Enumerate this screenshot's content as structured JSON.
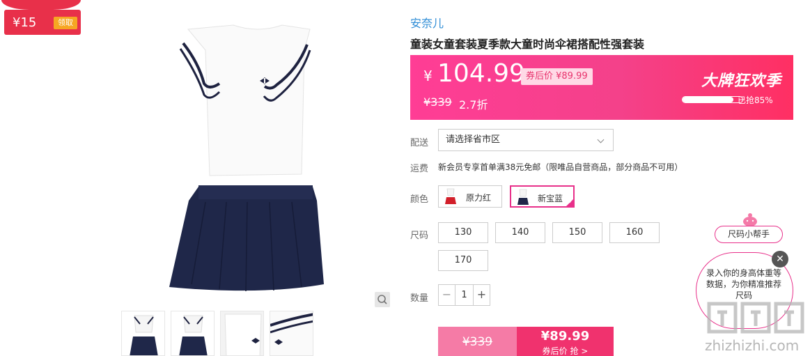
{
  "coupon": {
    "amount": "¥15",
    "claim_label": "领取"
  },
  "product": {
    "brand": "安奈儿",
    "title": "童装女童套装夏季款大童时尚伞裙搭配性强套装"
  },
  "price_panel": {
    "currency": "¥",
    "price": "104.99",
    "after_coupon": "券后价 ¥89.99",
    "original_price": "¥339",
    "discount": "2.7折",
    "promo_title": "大牌狂欢季",
    "progress_text": "已抢85%",
    "progress_fraction": 0.85
  },
  "delivery": {
    "label": "配送",
    "select_value": "请选择省市区"
  },
  "shipping": {
    "label": "运费",
    "text": "新会员专享首单满38元免邮（限唯品自营商品，部分商品不可用）"
  },
  "colors": {
    "label": "颜色",
    "options": [
      {
        "name": "原力红",
        "selected": false
      },
      {
        "name": "新宝蓝",
        "selected": true
      }
    ]
  },
  "sizes": {
    "label": "尺码",
    "options": [
      "130",
      "140",
      "150",
      "160",
      "170"
    ]
  },
  "quantity": {
    "label": "数量",
    "value": "1",
    "minus": "−",
    "plus": "+"
  },
  "buy": {
    "original_price": "¥339",
    "coupon_price": "¥89.99",
    "coupon_sub": "券后价 抢 >"
  },
  "size_helper": {
    "button_label": "尺码小帮手",
    "bubble_text": "录入你的身高体重等数据，为你精准推荐尺码",
    "close_symbol": "✕"
  },
  "watermark": {
    "text": "zhizhizhi.com"
  },
  "icons": [
    "zoom-icon",
    "chevron-down-icon",
    "check-icon",
    "close-icon",
    "mascot-icon"
  ],
  "colors_theme": {
    "brand_blue": "#2d8cd6",
    "accent_pink": "#e8308a",
    "coupon_red": "#e8304a"
  }
}
